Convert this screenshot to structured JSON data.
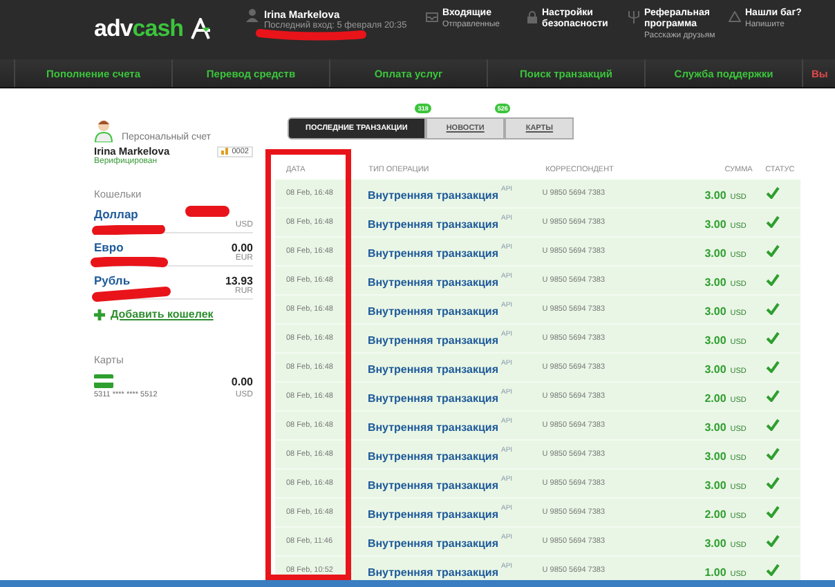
{
  "header": {
    "logo": {
      "first": "adv",
      "second": "cash"
    },
    "user": {
      "name": "Irina Markelova",
      "last_login": "Последний вход: 5 февраля 20:35"
    },
    "menu": [
      {
        "kind": "inbox",
        "title": "Входящие",
        "subtitle": "Отправленные"
      },
      {
        "kind": "lock",
        "title": "Настройки безопасности"
      },
      {
        "kind": "referral",
        "title": "Реферальная программа",
        "subtitle": "Расскажи друзьям"
      },
      {
        "kind": "bug",
        "title": "Нашли баг?",
        "subtitle": "Напишите"
      }
    ]
  },
  "nav": [
    {
      "label": "Пополнение счета",
      "color": "#3cc43c"
    },
    {
      "label": "Перевод средств",
      "color": "#3cc43c"
    },
    {
      "label": "Оплата услуг",
      "color": "#3cc43c"
    },
    {
      "label": "Поиск транзакций",
      "color": "#3cc43c"
    },
    {
      "label": "Служба поддержки",
      "color": "#3cc43c"
    },
    {
      "label": "Вы",
      "color": "#e04848"
    }
  ],
  "sidebar": {
    "account_type": "Персональный счет",
    "name": "Irina Markelova",
    "badge": "0002",
    "status": "Верифицирован",
    "wallets_title": "Кошельки",
    "wallets": [
      {
        "name": "Доллар",
        "currency": "USD"
      },
      {
        "name": "Евро",
        "amount": "0.00",
        "currency": "EUR"
      },
      {
        "name": "Рубль",
        "amount": "13.93",
        "currency": "RUR"
      }
    ],
    "add_wallet": "Добавить кошелек",
    "cards_title": "Карты",
    "cards": [
      {
        "number": "5311 **** **** 5512",
        "amount": "0.00",
        "currency": "USD"
      }
    ]
  },
  "tabs": [
    {
      "label": "ПОСЛЕДНИЕ ТРАНЗАКЦИИ",
      "selected": true,
      "count": "318"
    },
    {
      "label": "НОВОСТИ",
      "selected": false,
      "count": "526"
    },
    {
      "label": "КАРТЫ",
      "selected": false
    }
  ],
  "table": {
    "columns": [
      "ДАТА",
      "ТИП ОПЕРАЦИИ",
      "КОРРЕСПОНДЕНТ",
      "СУММА",
      "СТАТУС"
    ],
    "rows": [
      {
        "date": "08 Feb, 16:48",
        "type": "Внутренняя транзакция",
        "tag": "API",
        "correspondent": "U 9850 5694 7383",
        "amount": "3.00",
        "currency": "USD",
        "done": true
      },
      {
        "date": "08 Feb, 16:48",
        "type": "Внутренняя транзакция",
        "tag": "API",
        "correspondent": "U 9850 5694 7383",
        "amount": "3.00",
        "currency": "USD",
        "done": true
      },
      {
        "date": "08 Feb, 16:48",
        "type": "Внутренняя транзакция",
        "tag": "API",
        "correspondent": "U 9850 5694 7383",
        "amount": "3.00",
        "currency": "USD",
        "done": true
      },
      {
        "date": "08 Feb, 16:48",
        "type": "Внутренняя транзакция",
        "tag": "API",
        "correspondent": "U 9850 5694 7383",
        "amount": "3.00",
        "currency": "USD",
        "done": true
      },
      {
        "date": "08 Feb, 16:48",
        "type": "Внутренняя транзакция",
        "tag": "API",
        "correspondent": "U 9850 5694 7383",
        "amount": "3.00",
        "currency": "USD",
        "done": true
      },
      {
        "date": "08 Feb, 16:48",
        "type": "Внутренняя транзакция",
        "tag": "API",
        "correspondent": "U 9850 5694 7383",
        "amount": "3.00",
        "currency": "USD",
        "done": true
      },
      {
        "date": "08 Feb, 16:48",
        "type": "Внутренняя транзакция",
        "tag": "API",
        "correspondent": "U 9850 5694 7383",
        "amount": "3.00",
        "currency": "USD",
        "done": true
      },
      {
        "date": "08 Feb, 16:48",
        "type": "Внутренняя транзакция",
        "tag": "API",
        "correspondent": "U 9850 5694 7383",
        "amount": "2.00",
        "currency": "USD",
        "done": true
      },
      {
        "date": "08 Feb, 16:48",
        "type": "Внутренняя транзакция",
        "tag": "API",
        "correspondent": "U 9850 5694 7383",
        "amount": "3.00",
        "currency": "USD",
        "done": true
      },
      {
        "date": "08 Feb, 16:48",
        "type": "Внутренняя транзакция",
        "tag": "API",
        "correspondent": "U 9850 5694 7383",
        "amount": "3.00",
        "currency": "USD",
        "done": true
      },
      {
        "date": "08 Feb, 16:48",
        "type": "Внутренняя транзакция",
        "tag": "API",
        "correspondent": "U 9850 5694 7383",
        "amount": "3.00",
        "currency": "USD",
        "done": true
      },
      {
        "date": "08 Feb, 16:48",
        "type": "Внутренняя транзакция",
        "tag": "API",
        "correspondent": "U 9850 5694 7383",
        "amount": "2.00",
        "currency": "USD",
        "done": true
      },
      {
        "date": "08 Feb, 11:46",
        "type": "Внутренняя транзакция",
        "tag": "API",
        "correspondent": "U 9850 5694 7383",
        "amount": "3.00",
        "currency": "USD",
        "done": true
      },
      {
        "date": "08 Feb, 10:52",
        "type": "Внутренняя транзакция",
        "tag": "API",
        "correspondent": "U 9850 5694 7383",
        "amount": "1.00",
        "currency": "USD",
        "done": true
      }
    ]
  }
}
